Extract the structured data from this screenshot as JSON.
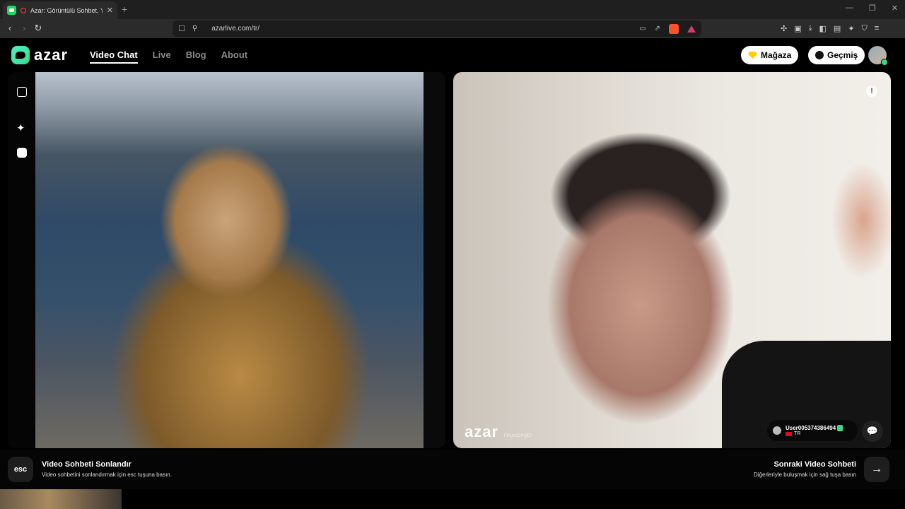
{
  "browser": {
    "tab_title": "Azar: Görüntülü Sohbet, Yeni",
    "url": "azarlive.com/tr/"
  },
  "site": {
    "logo": "azar",
    "nav": [
      {
        "label": "Video Chat",
        "active": true
      },
      {
        "label": "Live",
        "active": false
      },
      {
        "label": "Blog",
        "active": false
      },
      {
        "label": "About",
        "active": false
      }
    ],
    "store_button": "Mağaza",
    "history_button": "Geçmiş"
  },
  "remote_video": {
    "watermark_logo": "azar",
    "watermark_code": "FPLMJDPQE7",
    "username": "User005374386494",
    "country": "TR"
  },
  "bottom": {
    "esc_key": "esc",
    "end_title": "Video Sohbeti Sonlandır",
    "end_sub": "Video sohbetini sonlandırmak için esc tuşuna basın.",
    "next_title": "Sonraki Video Sohbeti",
    "next_sub": "Diğerleriyle buluşmak için sağ tuşa basın"
  },
  "colors": {
    "accent": "#39d98a",
    "background": "#000000"
  }
}
